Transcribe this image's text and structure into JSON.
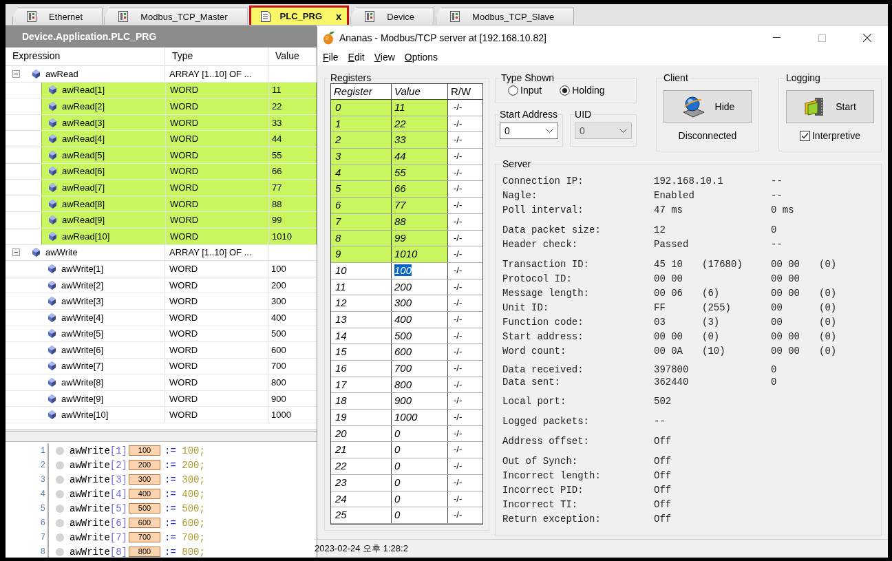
{
  "tabs": [
    {
      "label": "Ethernet",
      "kind": "device",
      "selected": false
    },
    {
      "label": "Modbus_TCP_Master",
      "kind": "device",
      "selected": false
    },
    {
      "label": "PLC_PRG",
      "kind": "program",
      "selected": true,
      "close": "x"
    },
    {
      "label": "Device",
      "kind": "device",
      "selected": false
    },
    {
      "label": "Modbus_TCP_Slave",
      "kind": "device",
      "selected": false
    }
  ],
  "watch": {
    "title": "Device.Application.PLC_PRG",
    "columns": [
      "Expression",
      "Type",
      "Value"
    ],
    "rows": [
      {
        "expression": "awRead",
        "type": "ARRAY [1..10] OF ...",
        "expanded": true,
        "children": [
          {
            "expression": "awRead[1]",
            "type": "WORD",
            "value": "11",
            "highlighted": true
          },
          {
            "expression": "awRead[2]",
            "type": "WORD",
            "value": "22",
            "highlighted": true
          },
          {
            "expression": "awRead[3]",
            "type": "WORD",
            "value": "33",
            "highlighted": true
          },
          {
            "expression": "awRead[4]",
            "type": "WORD",
            "value": "44",
            "highlighted": true
          },
          {
            "expression": "awRead[5]",
            "type": "WORD",
            "value": "55",
            "highlighted": true
          },
          {
            "expression": "awRead[6]",
            "type": "WORD",
            "value": "66",
            "highlighted": true
          },
          {
            "expression": "awRead[7]",
            "type": "WORD",
            "value": "77",
            "highlighted": true
          },
          {
            "expression": "awRead[8]",
            "type": "WORD",
            "value": "88",
            "highlighted": true
          },
          {
            "expression": "awRead[9]",
            "type": "WORD",
            "value": "99",
            "highlighted": true
          },
          {
            "expression": "awRead[10]",
            "type": "WORD",
            "value": "1010",
            "highlighted": true
          }
        ]
      },
      {
        "expression": "awWrite",
        "type": "ARRAY [1..10] OF ...",
        "expanded": true,
        "children": [
          {
            "expression": "awWrite[1]",
            "type": "WORD",
            "value": "100",
            "highlighted": false
          },
          {
            "expression": "awWrite[2]",
            "type": "WORD",
            "value": "200",
            "highlighted": false
          },
          {
            "expression": "awWrite[3]",
            "type": "WORD",
            "value": "300",
            "highlighted": false
          },
          {
            "expression": "awWrite[4]",
            "type": "WORD",
            "value": "400",
            "highlighted": false
          },
          {
            "expression": "awWrite[5]",
            "type": "WORD",
            "value": "500",
            "highlighted": false
          },
          {
            "expression": "awWrite[6]",
            "type": "WORD",
            "value": "600",
            "highlighted": false
          },
          {
            "expression": "awWrite[7]",
            "type": "WORD",
            "value": "700",
            "highlighted": false
          },
          {
            "expression": "awWrite[8]",
            "type": "WORD",
            "value": "800",
            "highlighted": false
          },
          {
            "expression": "awWrite[9]",
            "type": "WORD",
            "value": "900",
            "highlighted": false
          },
          {
            "expression": "awWrite[10]",
            "type": "WORD",
            "value": "1000",
            "highlighted": false
          }
        ]
      }
    ]
  },
  "code": {
    "lines": [
      {
        "number": "1",
        "variable": "awWrite",
        "index": "[1]",
        "monitor": "100",
        "operator": ":=",
        "literal": "100;"
      },
      {
        "number": "2",
        "variable": "awWrite",
        "index": "[2]",
        "monitor": "200",
        "operator": ":=",
        "literal": "200;"
      },
      {
        "number": "3",
        "variable": "awWrite",
        "index": "[3]",
        "monitor": "300",
        "operator": ":=",
        "literal": "300;"
      },
      {
        "number": "4",
        "variable": "awWrite",
        "index": "[4]",
        "monitor": "400",
        "operator": ":=",
        "literal": "400;"
      },
      {
        "number": "5",
        "variable": "awWrite",
        "index": "[5]",
        "monitor": "500",
        "operator": ":=",
        "literal": "500;"
      },
      {
        "number": "6",
        "variable": "awWrite",
        "index": "[6]",
        "monitor": "600",
        "operator": ":=",
        "literal": "600;"
      },
      {
        "number": "7",
        "variable": "awWrite",
        "index": "[7]",
        "monitor": "700",
        "operator": ":=",
        "literal": "700;"
      },
      {
        "number": "8",
        "variable": "awWrite",
        "index": "[8]",
        "monitor": "800",
        "operator": ":=",
        "literal": "800;"
      }
    ]
  },
  "server_window": {
    "title": "Ananas - Modbus/TCP server at [192.168.10.82]",
    "menu": [
      "File",
      "Edit",
      "View",
      "Options"
    ],
    "registers": {
      "title": "Registers",
      "columns": [
        "Register",
        "Value",
        "R/W"
      ],
      "rows": [
        {
          "register": "0",
          "value": "11",
          "rw": "-/-",
          "highlighted": true,
          "selected": false
        },
        {
          "register": "1",
          "value": "22",
          "rw": "-/-",
          "highlighted": true,
          "selected": false
        },
        {
          "register": "2",
          "value": "33",
          "rw": "-/-",
          "highlighted": true,
          "selected": false
        },
        {
          "register": "3",
          "value": "44",
          "rw": "-/-",
          "highlighted": true,
          "selected": false
        },
        {
          "register": "4",
          "value": "55",
          "rw": "-/-",
          "highlighted": true,
          "selected": false
        },
        {
          "register": "5",
          "value": "66",
          "rw": "-/-",
          "highlighted": true,
          "selected": false
        },
        {
          "register": "6",
          "value": "77",
          "rw": "-/-",
          "highlighted": true,
          "selected": false
        },
        {
          "register": "7",
          "value": "88",
          "rw": "-/-",
          "highlighted": true,
          "selected": false
        },
        {
          "register": "8",
          "value": "99",
          "rw": "-/-",
          "highlighted": true,
          "selected": false
        },
        {
          "register": "9",
          "value": "1010",
          "rw": "-/-",
          "highlighted": true,
          "selected": false
        },
        {
          "register": "10",
          "value": "100",
          "rw": "-/-",
          "highlighted": false,
          "selected": true
        },
        {
          "register": "11",
          "value": "200",
          "rw": "-/-",
          "highlighted": false,
          "selected": false
        },
        {
          "register": "12",
          "value": "300",
          "rw": "-/-",
          "highlighted": false,
          "selected": false
        },
        {
          "register": "13",
          "value": "400",
          "rw": "-/-",
          "highlighted": false,
          "selected": false
        },
        {
          "register": "14",
          "value": "500",
          "rw": "-/-",
          "highlighted": false,
          "selected": false
        },
        {
          "register": "15",
          "value": "600",
          "rw": "-/-",
          "highlighted": false,
          "selected": false
        },
        {
          "register": "16",
          "value": "700",
          "rw": "-/-",
          "highlighted": false,
          "selected": false
        },
        {
          "register": "17",
          "value": "800",
          "rw": "-/-",
          "highlighted": false,
          "selected": false
        },
        {
          "register": "18",
          "value": "900",
          "rw": "-/-",
          "highlighted": false,
          "selected": false
        },
        {
          "register": "19",
          "value": "1000",
          "rw": "-/-",
          "highlighted": false,
          "selected": false
        },
        {
          "register": "20",
          "value": "0",
          "rw": "-/-",
          "highlighted": false,
          "selected": false
        },
        {
          "register": "21",
          "value": "0",
          "rw": "-/-",
          "highlighted": false,
          "selected": false
        },
        {
          "register": "22",
          "value": "0",
          "rw": "-/-",
          "highlighted": false,
          "selected": false
        },
        {
          "register": "23",
          "value": "0",
          "rw": "-/-",
          "highlighted": false,
          "selected": false
        },
        {
          "register": "24",
          "value": "0",
          "rw": "-/-",
          "highlighted": false,
          "selected": false
        },
        {
          "register": "25",
          "value": "0",
          "rw": "-/-",
          "highlighted": false,
          "selected": false
        }
      ]
    },
    "type_shown": {
      "title": "Type Shown",
      "options": [
        {
          "label": "Input",
          "selected": false
        },
        {
          "label": "Holding",
          "selected": true
        }
      ]
    },
    "start_address": {
      "title": "Start Address",
      "value": "0",
      "disabled": false
    },
    "uid": {
      "title": "UID",
      "value": "0",
      "disabled": true
    },
    "client": {
      "title": "Client",
      "button": "Hide",
      "status": "Disconnected"
    },
    "logging": {
      "title": "Logging",
      "button": "Start",
      "checkbox": {
        "label": "Interpretive",
        "checked": true
      }
    },
    "server": {
      "title": "Server",
      "groups": [
        {
          "kind": "normal",
          "rows": [
            {
              "label": "Connection IP:",
              "column_2": "192.168.10.1",
              "column_4": "--"
            },
            {
              "label": "Nagle:",
              "column_2": "Enabled",
              "column_4": "--"
            },
            {
              "label": "Poll interval:",
              "column_2": "47 ms",
              "column_4": "0 ms"
            }
          ]
        },
        {
          "kind": "normal",
          "rows": [
            {
              "label": "Data packet size:",
              "column_2": "12",
              "column_4": "0"
            },
            {
              "label": "Header check:",
              "column_2": "Passed",
              "column_4": "--"
            }
          ]
        },
        {
          "kind": "normal",
          "rows": [
            {
              "label": "Transaction ID:",
              "column_2": "45 10",
              "column_3": "(17680)",
              "column_4": "00 00",
              "column_5": "(0)"
            },
            {
              "label": "Protocol ID:",
              "column_2": "00 00",
              "column_4": "00 00"
            },
            {
              "label": "Message length:",
              "column_2": "00 06",
              "column_3": "(6)",
              "column_4": "00 00",
              "column_5": "(0)"
            },
            {
              "label": "Unit ID:",
              "column_2": "FF",
              "column_3": "(255)",
              "column_4": "00",
              "column_5": "(0)"
            },
            {
              "label": "Function code:",
              "column_2": "03",
              "column_3": "(3)",
              "column_4": "00",
              "column_5": "(0)"
            },
            {
              "label": "Start address:",
              "column_2": "00 00",
              "column_3": "(0)",
              "column_4": "00 00",
              "column_5": "(0)"
            },
            {
              "label": "Word count:",
              "column_2": "00 0A",
              "column_3": "(10)",
              "column_4": "00 00",
              "column_5": "(0)"
            }
          ]
        },
        {
          "kind": "tight",
          "rows": [
            {
              "label": "Data received:",
              "column_2": "397800",
              "column_4": "0"
            },
            {
              "label": "Data sent:",
              "column_2": "362440",
              "column_4": "0"
            }
          ]
        },
        {
          "kind": "normal",
          "rows": [
            {
              "label": "Local port:",
              "column_2": "502"
            }
          ]
        },
        {
          "kind": "normal",
          "rows": [
            {
              "label": "Logged packets:",
              "column_2": "--"
            }
          ]
        },
        {
          "kind": "normal",
          "rows": [
            {
              "label": "Address offset:",
              "column_2": "Off"
            }
          ]
        },
        {
          "kind": "normal",
          "rows": [
            {
              "label": "Out of Synch:",
              "column_2": "Off"
            },
            {
              "label": "Incorrect length:",
              "column_2": "Off"
            },
            {
              "label": "Incorrect PID:",
              "column_2": "Off"
            },
            {
              "label": "Incorrect TI:",
              "column_2": "Off"
            },
            {
              "label": "Return exception:",
              "column_2": "Off"
            }
          ]
        }
      ]
    },
    "status_bar": "2023-02-24 오후 1:28:2"
  }
}
